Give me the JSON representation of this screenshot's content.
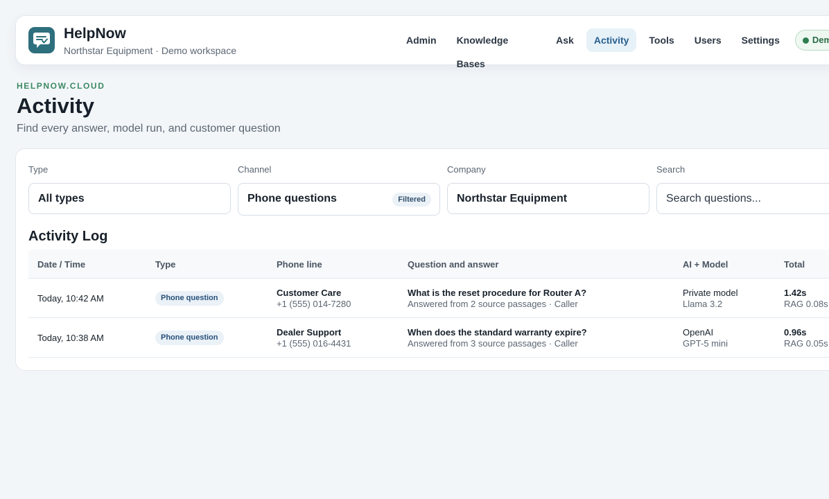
{
  "app": {
    "name": "HelpNow",
    "workspace": "Northstar Equipment · Demo workspace"
  },
  "nav": {
    "items": [
      "Admin",
      "Knowledge Bases",
      "Ask",
      "Activity",
      "Tools",
      "Users",
      "Settings"
    ],
    "active": "Activity",
    "demo_badge": "Demo"
  },
  "page": {
    "eyebrow": "HELPNOW.CLOUD",
    "title": "Activity",
    "subtitle": "Find every answer, model run, and customer question"
  },
  "filters": {
    "type": {
      "label": "Type",
      "value": "All types"
    },
    "channel": {
      "label": "Channel",
      "value": "Phone questions",
      "badge": "Filtered"
    },
    "company": {
      "label": "Company",
      "value": "Northstar Equipment"
    },
    "search": {
      "label": "Search",
      "placeholder": "Search questions..."
    }
  },
  "activity_log": {
    "title": "Activity Log",
    "columns": [
      "Date / Time",
      "Type",
      "Phone line",
      "Question and answer",
      "AI + Model",
      "Total"
    ],
    "rows": [
      {
        "datetime": "Today, 10:42 AM",
        "type": "Phone question",
        "line_name": "Customer Care",
        "line_number": "+1 (555) 014-7280",
        "question": "What is the reset procedure for Router A?",
        "answer_meta": "Answered from 2 source passages · Caller",
        "ai_provider": "Private model",
        "ai_model": "Llama 3.2",
        "total": "1.42s",
        "rag": "RAG 0.08s"
      },
      {
        "datetime": "Today, 10:38 AM",
        "type": "Phone question",
        "line_name": "Dealer Support",
        "line_number": "+1 (555) 016-4431",
        "question": "When does the standard warranty expire?",
        "answer_meta": "Answered from 3 source passages · Caller",
        "ai_provider": "OpenAI",
        "ai_model": "GPT-5 mini",
        "total": "0.96s",
        "rag": "RAG 0.05s"
      }
    ]
  },
  "colors": {
    "accent": "#27608f",
    "brand": "#2e6f7d",
    "success": "#2e7d4f"
  }
}
